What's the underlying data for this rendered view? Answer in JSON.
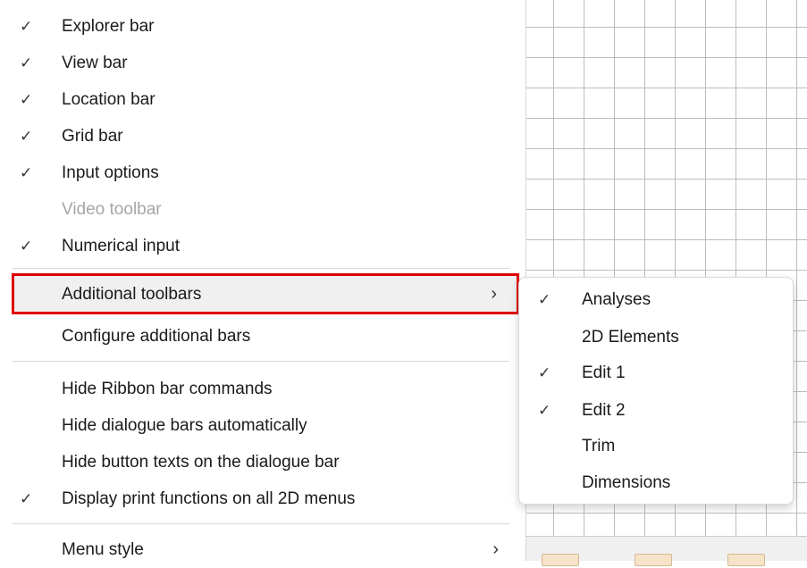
{
  "main_menu": {
    "items": [
      {
        "label": "Explorer bar",
        "checked": true,
        "enabled": true
      },
      {
        "label": "View bar",
        "checked": true,
        "enabled": true
      },
      {
        "label": "Location bar",
        "checked": true,
        "enabled": true
      },
      {
        "label": "Grid bar",
        "checked": true,
        "enabled": true
      },
      {
        "label": "Input options",
        "checked": true,
        "enabled": true
      },
      {
        "label": "Video toolbar",
        "checked": false,
        "enabled": false
      },
      {
        "label": "Numerical input",
        "checked": true,
        "enabled": true
      },
      {
        "label": "Additional toolbars",
        "checked": false,
        "enabled": true,
        "submenu": true,
        "highlighted": true
      },
      {
        "label": "Configure additional bars",
        "checked": false,
        "enabled": true
      },
      {
        "label": "Hide Ribbon bar commands",
        "checked": false,
        "enabled": true
      },
      {
        "label": "Hide dialogue bars automatically",
        "checked": false,
        "enabled": true
      },
      {
        "label": "Hide button texts on the dialogue bar",
        "checked": false,
        "enabled": true
      },
      {
        "label": "Display print functions on all 2D menus",
        "checked": true,
        "enabled": true
      },
      {
        "label": "Menu style",
        "checked": false,
        "enabled": true,
        "submenu": true
      }
    ]
  },
  "submenu": {
    "items": [
      {
        "label": "Analyses",
        "checked": true
      },
      {
        "label": "2D Elements",
        "checked": false
      },
      {
        "label": "Edit 1",
        "checked": true
      },
      {
        "label": "Edit 2",
        "checked": true
      },
      {
        "label": "Trim",
        "checked": false
      },
      {
        "label": "Dimensions",
        "checked": false
      }
    ]
  },
  "glyphs": {
    "check": "✓",
    "chevron": "›"
  },
  "colors": {
    "highlight_box": "#e00000",
    "disabled_text": "#a6a6a6"
  }
}
